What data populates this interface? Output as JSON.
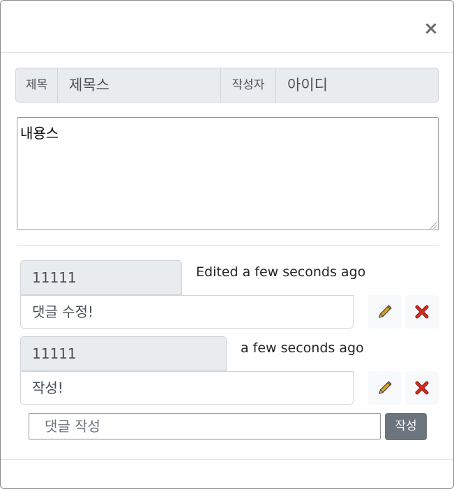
{
  "header": {
    "close_label": "×"
  },
  "post": {
    "title_label": "제목",
    "title_value": "제목스",
    "author_label": "작성자",
    "author_value": "아이디",
    "content": "내용스"
  },
  "comments": [
    {
      "author": "11111",
      "meta": "Edited a few seconds ago",
      "body": "댓글 수정!",
      "edit_icon": "pencil-icon",
      "delete_icon": "x-icon"
    },
    {
      "author": "11111",
      "meta": "a few seconds ago",
      "body": "작성!",
      "edit_icon": "pencil-icon",
      "delete_icon": "x-icon"
    }
  ],
  "new_comment": {
    "placeholder": "댓글 작성",
    "submit_label": "작성"
  },
  "colors": {
    "pencil": "#e3a21a",
    "delete": "#d62b1f",
    "submit_bg": "#6c757d"
  }
}
